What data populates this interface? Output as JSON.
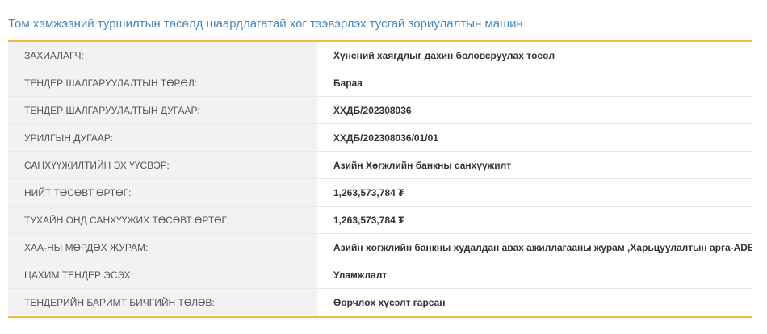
{
  "title": "Том хэмжээний туршилтын төсөлд шаардлагатай хог тээвэрлэх тусгай зориулалтын машин",
  "accent_color": "#ecbd3c",
  "title_color": "#4a86b8",
  "rows": [
    {
      "label": "ЗАХИАЛАГЧ:",
      "value": "Хүнсний хаягдлыг дахин боловсруулах төсөл"
    },
    {
      "label": "ТЕНДЕР ШАЛГАРУУЛАЛТЫН ТӨРӨЛ:",
      "value": "Бараа"
    },
    {
      "label": "ТЕНДЕР ШАЛГАРУУЛАЛТЫН ДУГААР:",
      "value": "ХХДБ/202308036"
    },
    {
      "label": "УРИЛГЫН ДУГААР:",
      "value": "ХХДБ/202308036/01/01"
    },
    {
      "label": "САНХҮҮЖИЛТИЙН ЭХ ҮҮСВЭР:",
      "value": "Азийн Хөгжлийн банкны санхүүжилт"
    },
    {
      "label": "НИЙТ ТӨСӨВТ ӨРТӨГ:",
      "value": "1,263,573,784 ₮"
    },
    {
      "label": "ТУХАЙН ОНД САНХҮҮЖИХ ТӨСӨВТ ӨРТӨГ:",
      "value": "1,263,573,784 ₮"
    },
    {
      "label": "ХАА-НЫ МӨРДӨХ ЖУРАМ:",
      "value": "Азийн хөгжлийн банкны худалдан авах ажиллагааны журам ,Харьцуулалтын арга-ADB"
    },
    {
      "label": "ЦАХИМ ТЕНДЕР ЭСЭХ:",
      "value": "Уламжлалт"
    },
    {
      "label": "ТЕНДЕРИЙН БАРИМТ БИЧГИЙН ТӨЛӨВ:",
      "value": "Өөрчлөх хүсэлт гарсан"
    }
  ]
}
